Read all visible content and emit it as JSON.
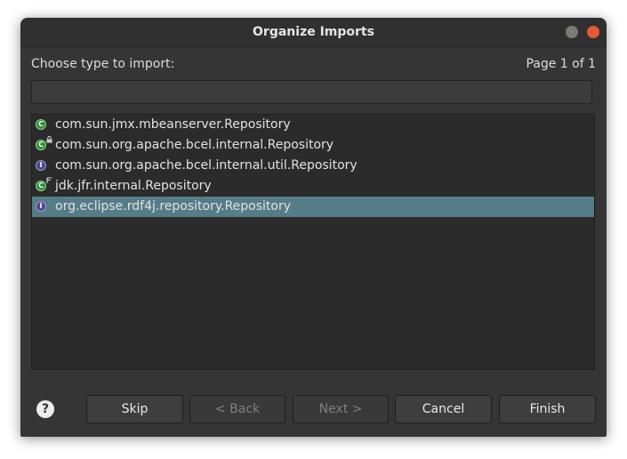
{
  "window": {
    "title": "Organize Imports"
  },
  "header": {
    "choose_label": "Choose type to import:",
    "page_label": "Page 1 of 1"
  },
  "filter": {
    "value": "",
    "placeholder": ""
  },
  "types": [
    {
      "label": "com.sun.jmx.mbeanserver.Repository",
      "kind": "class",
      "icon": "class-icon",
      "overlay": "",
      "selected": false
    },
    {
      "label": "com.sun.org.apache.bcel.internal.Repository",
      "kind": "class",
      "icon": "class-icon",
      "overlay": "lock-icon",
      "selected": false
    },
    {
      "label": "com.sun.org.apache.bcel.internal.util.Repository",
      "kind": "interface",
      "icon": "interface-icon",
      "overlay": "",
      "selected": false
    },
    {
      "label": "jdk.jfr.internal.Repository",
      "kind": "class",
      "icon": "class-icon",
      "overlay": "final-flag-icon",
      "selected": false
    },
    {
      "label": "org.eclipse.rdf4j.repository.Repository",
      "kind": "interface",
      "icon": "interface-icon",
      "overlay": "",
      "selected": true
    }
  ],
  "icons": {
    "class_letter": "C",
    "interface_letter": "I",
    "help_glyph": "?"
  },
  "buttons": {
    "skip": "Skip",
    "back": "< Back",
    "next": "Next >",
    "cancel": "Cancel",
    "finish": "Finish"
  },
  "colors": {
    "background": "#353535",
    "list_background": "#2b2b2b",
    "selection": "#567c88",
    "close_button": "#e05b34",
    "minimize_button": "#7b7b76",
    "class_icon": "#2f8c3a",
    "interface_icon": "#4f4a8f"
  }
}
